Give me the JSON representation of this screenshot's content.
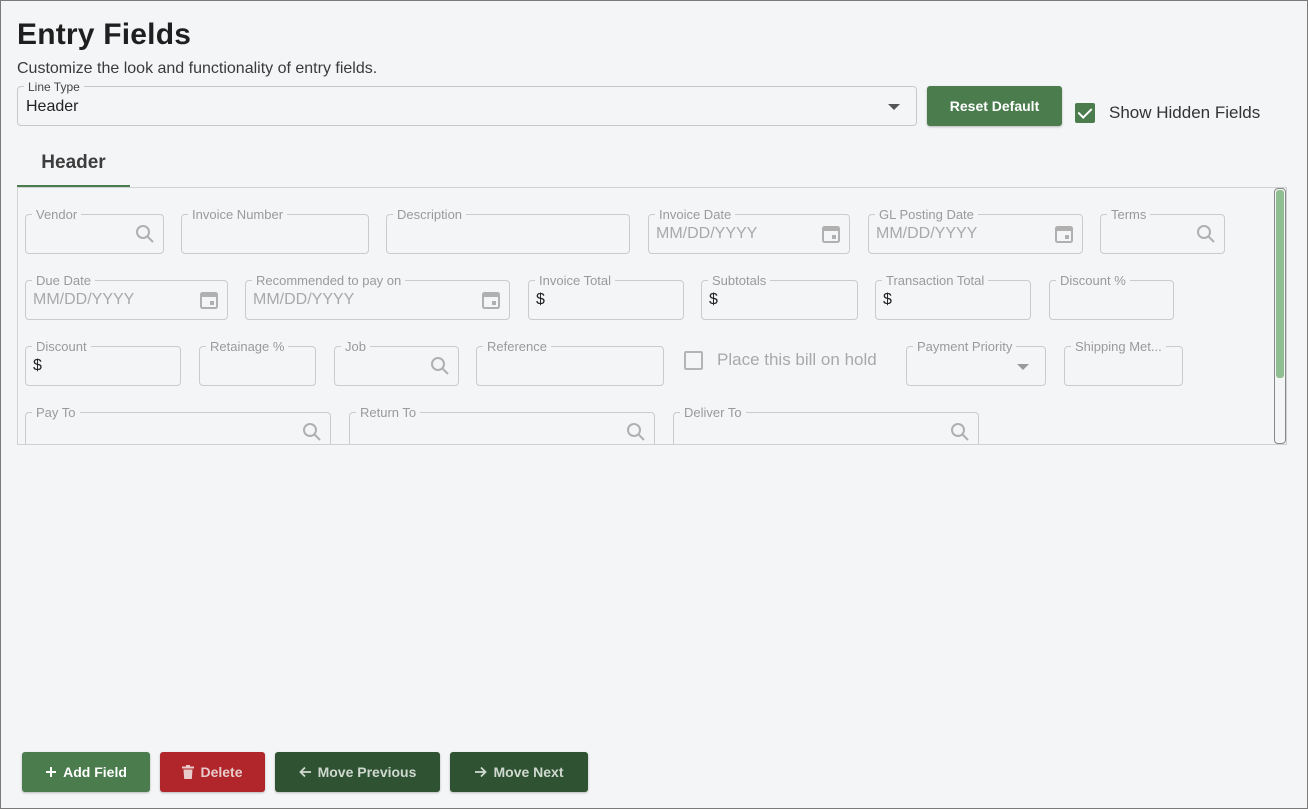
{
  "header": {
    "title": "Entry Fields",
    "subtitle": "Customize the look and functionality of entry fields."
  },
  "controls": {
    "line_type_label": "Line Type",
    "line_type_value": "Header",
    "reset_label": "Reset Default",
    "show_hidden_label": "Show Hidden Fields",
    "show_hidden_checked": true
  },
  "tabs": [
    {
      "label": "Header",
      "active": true
    }
  ],
  "fields": {
    "vendor": {
      "label": "Vendor"
    },
    "invoice_number": {
      "label": "Invoice Number"
    },
    "description": {
      "label": "Description"
    },
    "invoice_date": {
      "label": "Invoice Date",
      "placeholder": "MM/DD/YYYY"
    },
    "gl_posting_date": {
      "label": "GL Posting Date",
      "placeholder": "MM/DD/YYYY"
    },
    "terms": {
      "label": "Terms"
    },
    "due_date": {
      "label": "Due Date",
      "placeholder": "MM/DD/YYYY"
    },
    "recommended_pay": {
      "label": "Recommended to pay on",
      "placeholder": "MM/DD/YYYY"
    },
    "invoice_total": {
      "label": "Invoice Total",
      "value": "$"
    },
    "subtotals": {
      "label": "Subtotals",
      "value": "$"
    },
    "transaction_total": {
      "label": "Transaction Total",
      "value": "$"
    },
    "discount_pct": {
      "label": "Discount %"
    },
    "discount": {
      "label": "Discount",
      "value": "$"
    },
    "retainage_pct": {
      "label": "Retainage %"
    },
    "job": {
      "label": "Job"
    },
    "reference": {
      "label": "Reference"
    },
    "hold": {
      "label": "Place this bill on hold",
      "checked": false
    },
    "payment_priority": {
      "label": "Payment Priority"
    },
    "shipping_method": {
      "label": "Shipping Met..."
    },
    "pay_to": {
      "label": "Pay To"
    },
    "return_to": {
      "label": "Return To"
    },
    "deliver_to": {
      "label": "Deliver To"
    }
  },
  "actions": {
    "add_label": "Add Field",
    "delete_label": "Delete",
    "prev_label": "Move Previous",
    "next_label": "Move Next"
  },
  "colors": {
    "primary": "#4a7c4e",
    "danger": "#b0262a",
    "dark_green": "#2f5233",
    "scroll_thumb": "#8fbf90"
  }
}
